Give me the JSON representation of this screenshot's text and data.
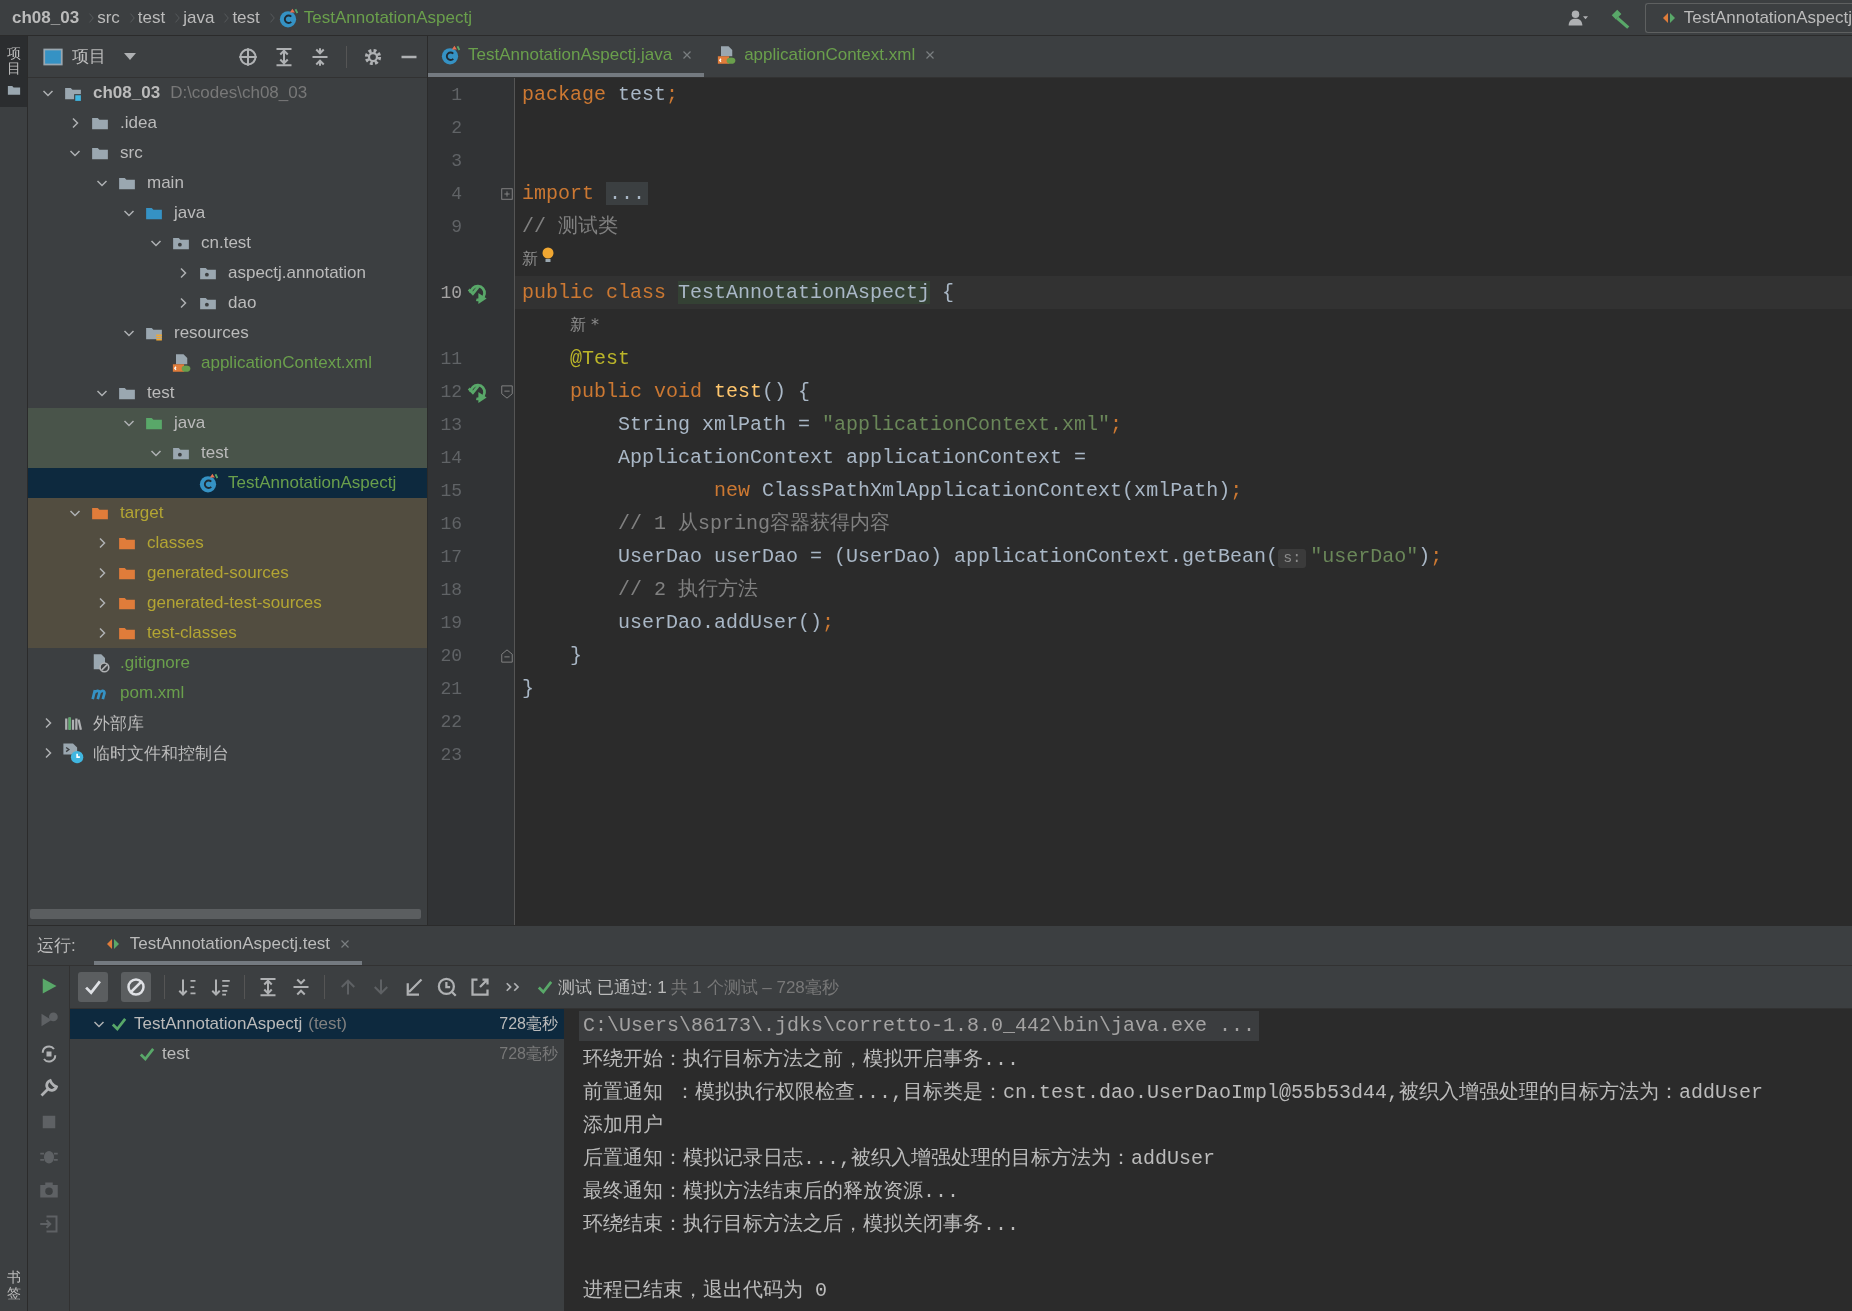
{
  "breadcrumbs": [
    {
      "label": "ch08_03",
      "kind": "project"
    },
    {
      "label": "src",
      "kind": "folder"
    },
    {
      "label": "test",
      "kind": "folder"
    },
    {
      "label": "java",
      "kind": "folder"
    },
    {
      "label": "test",
      "kind": "folder"
    },
    {
      "label": "TestAnnotationAspectj",
      "kind": "class"
    }
  ],
  "run_config": {
    "label": "TestAnnotationAspectj"
  },
  "side_stripe": [
    {
      "label": "项目",
      "selected": true
    },
    {
      "label": "书签",
      "selected": false
    }
  ],
  "project": {
    "title": "项目",
    "tree": [
      {
        "label": "ch08_03",
        "note": "D:\\codes\\ch08_03",
        "kind": "module",
        "expanded": true,
        "selected": false,
        "added": false,
        "children": [
          {
            "label": ".idea",
            "kind": "folder",
            "expanded": false,
            "selected": false,
            "added": false
          },
          {
            "label": "src",
            "kind": "folder",
            "expanded": true,
            "selected": false,
            "added": false,
            "children": [
              {
                "label": "main",
                "kind": "folder",
                "expanded": true,
                "selected": false,
                "added": false,
                "children": [
                  {
                    "label": "java",
                    "kind": "source-root",
                    "expanded": true,
                    "selected": false,
                    "added": false,
                    "children": [
                      {
                        "label": "cn.test",
                        "kind": "package",
                        "expanded": true,
                        "selected": false,
                        "added": false,
                        "children": [
                          {
                            "label": "aspectj.annotation",
                            "kind": "package",
                            "expanded": false,
                            "selected": false,
                            "added": false
                          },
                          {
                            "label": "dao",
                            "kind": "package",
                            "expanded": false,
                            "selected": false,
                            "added": false
                          }
                        ]
                      }
                    ]
                  },
                  {
                    "label": "resources",
                    "kind": "resources",
                    "expanded": true,
                    "selected": false,
                    "added": false,
                    "children": [
                      {
                        "label": "applicationContext.xml",
                        "kind": "xml",
                        "selected": false,
                        "added": true
                      }
                    ]
                  }
                ]
              },
              {
                "label": "test",
                "kind": "folder",
                "expanded": true,
                "selected": false,
                "added": false,
                "children": [
                  {
                    "label": "java",
                    "kind": "test-root",
                    "expanded": true,
                    "selected": false,
                    "added": false,
                    "children": [
                      {
                        "label": "test",
                        "kind": "package",
                        "expanded": true,
                        "selected": false,
                        "added": false,
                        "children": [
                          {
                            "label": "TestAnnotationAspectj",
                            "kind": "class",
                            "selected": true,
                            "added": true
                          }
                        ]
                      }
                    ]
                  }
                ]
              }
            ]
          },
          {
            "label": "target",
            "kind": "excluded",
            "expanded": true,
            "selected": false,
            "added": false,
            "children": [
              {
                "label": "classes",
                "kind": "excluded",
                "expanded": false,
                "selected": false,
                "added": false
              },
              {
                "label": "generated-sources",
                "kind": "excluded",
                "expanded": false,
                "selected": false,
                "added": false
              },
              {
                "label": "generated-test-sources",
                "kind": "excluded",
                "expanded": false,
                "selected": false,
                "added": false
              },
              {
                "label": "test-classes",
                "kind": "excluded",
                "expanded": false,
                "selected": false,
                "added": false
              }
            ]
          },
          {
            "label": ".gitignore",
            "kind": "gitignore",
            "selected": false,
            "added": true
          },
          {
            "label": "pom.xml",
            "kind": "pom",
            "selected": false,
            "added": true
          }
        ]
      },
      {
        "label": "外部库",
        "kind": "libraries",
        "expanded": false,
        "selected": false,
        "added": false
      },
      {
        "label": "临时文件和控制台",
        "kind": "scratches",
        "expanded": false,
        "selected": false,
        "added": false
      }
    ]
  },
  "editor": {
    "tabs": [
      {
        "label": "TestAnnotationAspectj.java",
        "kind": "class",
        "selected": true
      },
      {
        "label": "applicationContext.xml",
        "kind": "xml",
        "selected": false
      }
    ],
    "lines": [
      {
        "kind": "code",
        "number": "1",
        "current": false,
        "tokens": [
          {
            "kind": "kw",
            "text": "package "
          },
          {
            "kind": "p",
            "text": "test"
          },
          {
            "kind": "kw",
            "text": ";"
          }
        ]
      },
      {
        "kind": "code",
        "number": "2",
        "current": false
      },
      {
        "kind": "code",
        "number": "3",
        "current": false
      },
      {
        "kind": "code",
        "number": "4",
        "current": false,
        "folded": true,
        "tokens": [
          {
            "kind": "kw",
            "text": "import "
          },
          {
            "kind": "fold",
            "text": "..."
          }
        ]
      },
      {
        "kind": "code",
        "number": "9",
        "current": false,
        "tokens": [
          {
            "kind": "cm",
            "text": "// 测试类"
          }
        ]
      },
      {
        "kind": "inlay",
        "bulb": true,
        "indented": false,
        "text": "新"
      },
      {
        "kind": "code",
        "number": "10",
        "current": true,
        "run": true,
        "tokens": [
          {
            "kind": "kw",
            "text": "public class "
          },
          {
            "kind": "hl",
            "text": "TestAnnotationAspectj"
          },
          {
            "kind": "p",
            "text": " {"
          }
        ]
      },
      {
        "kind": "inlay",
        "indented": true,
        "text": "新 *"
      },
      {
        "kind": "code",
        "number": "11",
        "current": false,
        "tokens": [
          {
            "kind": "ann",
            "text": "    @Test"
          }
        ]
      },
      {
        "kind": "code",
        "number": "12",
        "current": false,
        "run": true,
        "fold_start": true,
        "tokens": [
          {
            "kind": "kw",
            "text": "    public void "
          },
          {
            "kind": "fn",
            "text": "test"
          },
          {
            "kind": "p",
            "text": "() {"
          }
        ]
      },
      {
        "kind": "code",
        "number": "13",
        "current": false,
        "tokens": [
          {
            "kind": "p",
            "text": "        String xmlPath = "
          },
          {
            "kind": "str",
            "text": "\"applicationContext.xml\""
          },
          {
            "kind": "kw",
            "text": ";"
          }
        ]
      },
      {
        "kind": "code",
        "number": "14",
        "current": false,
        "tokens": [
          {
            "kind": "p",
            "text": "        ApplicationContext applicationContext ="
          }
        ]
      },
      {
        "kind": "code",
        "number": "15",
        "current": false,
        "tokens": [
          {
            "kind": "kw",
            "text": "                new "
          },
          {
            "kind": "p",
            "text": "ClassPathXmlApplicationContext(xmlPath)"
          },
          {
            "kind": "kw",
            "text": ";"
          }
        ]
      },
      {
        "kind": "code",
        "number": "16",
        "current": false,
        "tokens": [
          {
            "kind": "cm",
            "text": "        // 1 从spring容器获得内容"
          }
        ]
      },
      {
        "kind": "code",
        "number": "17",
        "current": false,
        "tokens": [
          {
            "kind": "p",
            "text": "        UserDao userDao = (UserDao) applicationContext.getBean("
          },
          {
            "kind": "hint",
            "text": "s:"
          },
          {
            "kind": "str",
            "text": "\"userDao\""
          },
          {
            "kind": "p",
            "text": ")"
          },
          {
            "kind": "kw",
            "text": ";"
          }
        ]
      },
      {
        "kind": "code",
        "number": "18",
        "current": false,
        "tokens": [
          {
            "kind": "cm",
            "text": "        // 2 执行方法"
          }
        ]
      },
      {
        "kind": "code",
        "number": "19",
        "current": false,
        "tokens": [
          {
            "kind": "p",
            "text": "        userDao.addUser()"
          },
          {
            "kind": "kw",
            "text": ";"
          }
        ]
      },
      {
        "kind": "code",
        "number": "20",
        "current": false,
        "fold_end": true,
        "tokens": [
          {
            "kind": "p",
            "text": "    }"
          }
        ]
      },
      {
        "kind": "code",
        "number": "21",
        "current": false,
        "tokens": [
          {
            "kind": "p",
            "text": "}"
          }
        ]
      },
      {
        "kind": "code",
        "number": "22",
        "current": false
      },
      {
        "kind": "code",
        "number": "23",
        "current": false
      }
    ]
  },
  "run": {
    "label": "运行:",
    "tabs": [
      {
        "label": "TestAnnotationAspectj.test",
        "selected": true
      }
    ],
    "toggles": [
      {
        "kind": "passed",
        "on": true
      },
      {
        "kind": "ignored",
        "on": true
      }
    ],
    "status": "测试 已通过: 1",
    "summary": "共 1 个测试 – 728毫秒",
    "tests": [
      {
        "name": "TestAnnotationAspectj",
        "suffix": "(test)",
        "time": "728毫秒",
        "passed": true,
        "selected": true,
        "expanded": true,
        "children": [
          {
            "name": "test",
            "time": "728毫秒",
            "passed": true,
            "selected": false
          }
        ]
      }
    ],
    "console": [
      {
        "kind": "command",
        "text": "C:\\Users\\86173\\.jdks\\corretto-1.8.0_442\\bin\\java.exe ..."
      },
      {
        "kind": "out",
        "text": "环绕开始：执行目标方法之前，模拟开启事务..."
      },
      {
        "kind": "out",
        "text": "前置通知 ：模拟执行权限检查...,目标类是：cn.test.dao.UserDaoImpl@55b53d44,被织入增强处理的目标方法为：addUser"
      },
      {
        "kind": "out",
        "text": "添加用户"
      },
      {
        "kind": "out",
        "text": "后置通知：模拟记录日志...,被织入增强处理的目标方法为：addUser"
      },
      {
        "kind": "out",
        "text": "最终通知：模拟方法结束后的释放资源..."
      },
      {
        "kind": "out",
        "text": "环绕结束：执行目标方法之后，模拟关闭事务..."
      },
      {
        "kind": "exit",
        "text": "进程已结束，退出代码为 0"
      }
    ]
  }
}
